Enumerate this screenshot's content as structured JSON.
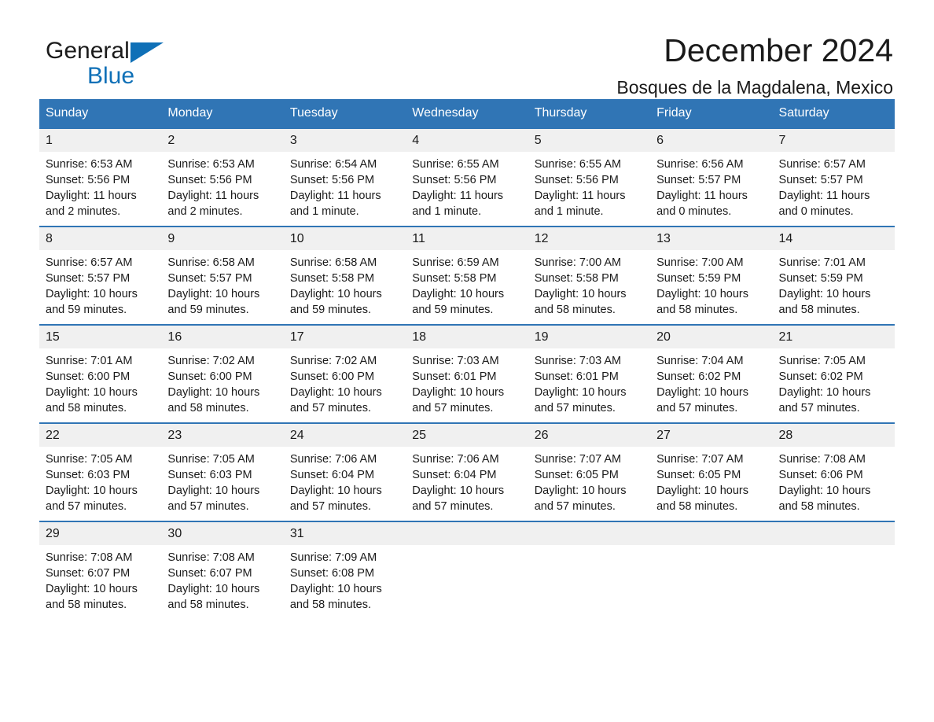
{
  "brand": {
    "name_part1": "General",
    "name_part2": "Blue",
    "accent_color": "#0f70b7"
  },
  "header": {
    "month_title": "December 2024",
    "location": "Bosques de la Magdalena, Mexico"
  },
  "theme": {
    "header_blue": "#3075b5",
    "daynum_band": "#f0f0f0",
    "text": "#1a1a1a"
  },
  "weekday_headers": [
    "Sunday",
    "Monday",
    "Tuesday",
    "Wednesday",
    "Thursday",
    "Friday",
    "Saturday"
  ],
  "labels": {
    "sunrise_prefix": "Sunrise:",
    "sunset_prefix": "Sunset:",
    "daylight_prefix": "Daylight:"
  },
  "weeks": [
    [
      {
        "day": "1",
        "sunrise": "Sunrise: 6:53 AM",
        "sunset": "Sunset: 5:56 PM",
        "daylight": "Daylight: 11 hours and 2 minutes."
      },
      {
        "day": "2",
        "sunrise": "Sunrise: 6:53 AM",
        "sunset": "Sunset: 5:56 PM",
        "daylight": "Daylight: 11 hours and 2 minutes."
      },
      {
        "day": "3",
        "sunrise": "Sunrise: 6:54 AM",
        "sunset": "Sunset: 5:56 PM",
        "daylight": "Daylight: 11 hours and 1 minute."
      },
      {
        "day": "4",
        "sunrise": "Sunrise: 6:55 AM",
        "sunset": "Sunset: 5:56 PM",
        "daylight": "Daylight: 11 hours and 1 minute."
      },
      {
        "day": "5",
        "sunrise": "Sunrise: 6:55 AM",
        "sunset": "Sunset: 5:56 PM",
        "daylight": "Daylight: 11 hours and 1 minute."
      },
      {
        "day": "6",
        "sunrise": "Sunrise: 6:56 AM",
        "sunset": "Sunset: 5:57 PM",
        "daylight": "Daylight: 11 hours and 0 minutes."
      },
      {
        "day": "7",
        "sunrise": "Sunrise: 6:57 AM",
        "sunset": "Sunset: 5:57 PM",
        "daylight": "Daylight: 11 hours and 0 minutes."
      }
    ],
    [
      {
        "day": "8",
        "sunrise": "Sunrise: 6:57 AM",
        "sunset": "Sunset: 5:57 PM",
        "daylight": "Daylight: 10 hours and 59 minutes."
      },
      {
        "day": "9",
        "sunrise": "Sunrise: 6:58 AM",
        "sunset": "Sunset: 5:57 PM",
        "daylight": "Daylight: 10 hours and 59 minutes."
      },
      {
        "day": "10",
        "sunrise": "Sunrise: 6:58 AM",
        "sunset": "Sunset: 5:58 PM",
        "daylight": "Daylight: 10 hours and 59 minutes."
      },
      {
        "day": "11",
        "sunrise": "Sunrise: 6:59 AM",
        "sunset": "Sunset: 5:58 PM",
        "daylight": "Daylight: 10 hours and 59 minutes."
      },
      {
        "day": "12",
        "sunrise": "Sunrise: 7:00 AM",
        "sunset": "Sunset: 5:58 PM",
        "daylight": "Daylight: 10 hours and 58 minutes."
      },
      {
        "day": "13",
        "sunrise": "Sunrise: 7:00 AM",
        "sunset": "Sunset: 5:59 PM",
        "daylight": "Daylight: 10 hours and 58 minutes."
      },
      {
        "day": "14",
        "sunrise": "Sunrise: 7:01 AM",
        "sunset": "Sunset: 5:59 PM",
        "daylight": "Daylight: 10 hours and 58 minutes."
      }
    ],
    [
      {
        "day": "15",
        "sunrise": "Sunrise: 7:01 AM",
        "sunset": "Sunset: 6:00 PM",
        "daylight": "Daylight: 10 hours and 58 minutes."
      },
      {
        "day": "16",
        "sunrise": "Sunrise: 7:02 AM",
        "sunset": "Sunset: 6:00 PM",
        "daylight": "Daylight: 10 hours and 58 minutes."
      },
      {
        "day": "17",
        "sunrise": "Sunrise: 7:02 AM",
        "sunset": "Sunset: 6:00 PM",
        "daylight": "Daylight: 10 hours and 57 minutes."
      },
      {
        "day": "18",
        "sunrise": "Sunrise: 7:03 AM",
        "sunset": "Sunset: 6:01 PM",
        "daylight": "Daylight: 10 hours and 57 minutes."
      },
      {
        "day": "19",
        "sunrise": "Sunrise: 7:03 AM",
        "sunset": "Sunset: 6:01 PM",
        "daylight": "Daylight: 10 hours and 57 minutes."
      },
      {
        "day": "20",
        "sunrise": "Sunrise: 7:04 AM",
        "sunset": "Sunset: 6:02 PM",
        "daylight": "Daylight: 10 hours and 57 minutes."
      },
      {
        "day": "21",
        "sunrise": "Sunrise: 7:05 AM",
        "sunset": "Sunset: 6:02 PM",
        "daylight": "Daylight: 10 hours and 57 minutes."
      }
    ],
    [
      {
        "day": "22",
        "sunrise": "Sunrise: 7:05 AM",
        "sunset": "Sunset: 6:03 PM",
        "daylight": "Daylight: 10 hours and 57 minutes."
      },
      {
        "day": "23",
        "sunrise": "Sunrise: 7:05 AM",
        "sunset": "Sunset: 6:03 PM",
        "daylight": "Daylight: 10 hours and 57 minutes."
      },
      {
        "day": "24",
        "sunrise": "Sunrise: 7:06 AM",
        "sunset": "Sunset: 6:04 PM",
        "daylight": "Daylight: 10 hours and 57 minutes."
      },
      {
        "day": "25",
        "sunrise": "Sunrise: 7:06 AM",
        "sunset": "Sunset: 6:04 PM",
        "daylight": "Daylight: 10 hours and 57 minutes."
      },
      {
        "day": "26",
        "sunrise": "Sunrise: 7:07 AM",
        "sunset": "Sunset: 6:05 PM",
        "daylight": "Daylight: 10 hours and 57 minutes."
      },
      {
        "day": "27",
        "sunrise": "Sunrise: 7:07 AM",
        "sunset": "Sunset: 6:05 PM",
        "daylight": "Daylight: 10 hours and 58 minutes."
      },
      {
        "day": "28",
        "sunrise": "Sunrise: 7:08 AM",
        "sunset": "Sunset: 6:06 PM",
        "daylight": "Daylight: 10 hours and 58 minutes."
      }
    ],
    [
      {
        "day": "29",
        "sunrise": "Sunrise: 7:08 AM",
        "sunset": "Sunset: 6:07 PM",
        "daylight": "Daylight: 10 hours and 58 minutes."
      },
      {
        "day": "30",
        "sunrise": "Sunrise: 7:08 AM",
        "sunset": "Sunset: 6:07 PM",
        "daylight": "Daylight: 10 hours and 58 minutes."
      },
      {
        "day": "31",
        "sunrise": "Sunrise: 7:09 AM",
        "sunset": "Sunset: 6:08 PM",
        "daylight": "Daylight: 10 hours and 58 minutes."
      },
      {
        "day": "",
        "sunrise": "",
        "sunset": "",
        "daylight": ""
      },
      {
        "day": "",
        "sunrise": "",
        "sunset": "",
        "daylight": ""
      },
      {
        "day": "",
        "sunrise": "",
        "sunset": "",
        "daylight": ""
      },
      {
        "day": "",
        "sunrise": "",
        "sunset": "",
        "daylight": ""
      }
    ]
  ]
}
